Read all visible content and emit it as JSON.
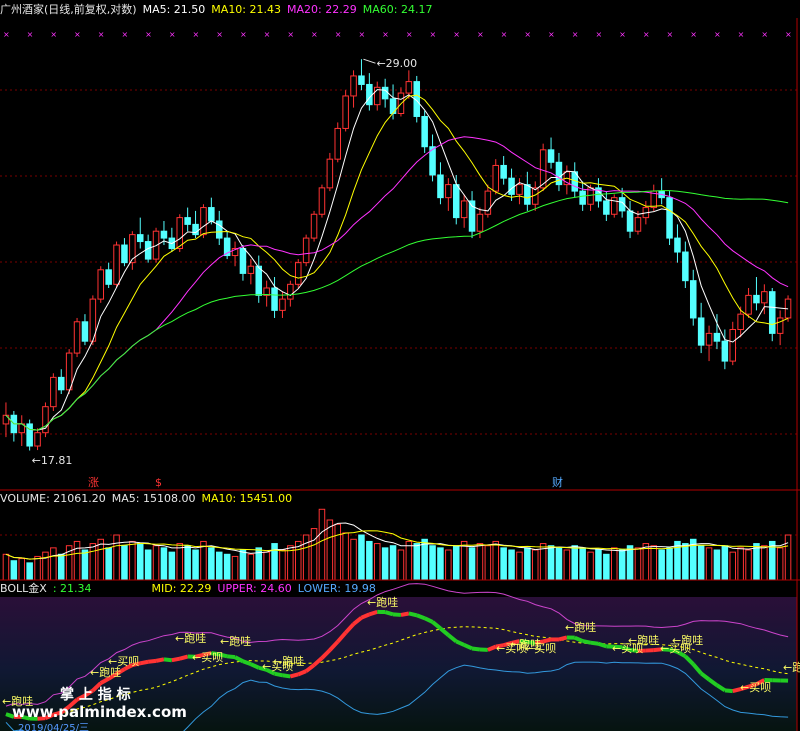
{
  "price_panel": {
    "header": [
      {
        "text": "广州酒家(日线,前复权,对数)",
        "color": "#e6e6e6"
      },
      {
        "text": "MA5: 21.50",
        "color": "#ffffff"
      },
      {
        "text": "MA10: 21.43",
        "color": "#ffff00"
      },
      {
        "text": "MA20: 22.29",
        "color": "#ff33ff"
      },
      {
        "text": "MA60: 24.17",
        "color": "#33ff33"
      }
    ],
    "high_label": "29.00",
    "low_label": "17.81",
    "markers": [
      {
        "text": "涨",
        "color": "#ff3333"
      },
      {
        "text": "$",
        "color": "#ff3333"
      },
      {
        "text": "财",
        "color": "#55aaff"
      }
    ]
  },
  "volume_panel": {
    "header": [
      {
        "text": "VOLUME: 21061.20",
        "color": "#e6e6e6"
      },
      {
        "text": "MA5: 15108.00",
        "color": "#e6e6e6"
      },
      {
        "text": "MA10: 15451.00",
        "color": "#ffff00"
      }
    ]
  },
  "boll_panel": {
    "header": [
      {
        "text": "BOLL金X",
        "color": "#e6e6e6"
      },
      {
        "text": ": 21.34",
        "color": "#33ff33"
      },
      {
        "text": "MID: 22.29",
        "color": "#ffff00"
      },
      {
        "text": "UPPER: 24.60",
        "color": "#ff33ff"
      },
      {
        "text": "LOWER: 19.98",
        "color": "#55aaff"
      }
    ],
    "signal_labels": [
      "跑哇",
      "跑哇",
      "跑哇",
      "买呗",
      "跑哇",
      "买呗",
      "跑哇",
      "买呗",
      "跑哇",
      "跑哇",
      "买呗",
      "跑哇",
      "买呗",
      "跑哇",
      "跑哇",
      "买呗",
      "买呗",
      "跑哇",
      "买呗"
    ],
    "watermark_cn": "掌 上 指 标",
    "watermark_url": "www.palmindex.com",
    "date_text": "2019/04/25/三"
  },
  "chart_data": [
    {
      "type": "candlestick",
      "title": "广州酒家(日线,前复权,对数)",
      "high": 29.0,
      "low": 17.81,
      "indicators": [
        {
          "name": "MA5",
          "value": 21.5,
          "color": "#ffffff"
        },
        {
          "name": "MA10",
          "value": 21.43,
          "color": "#ffff00"
        },
        {
          "name": "MA20",
          "value": 22.29,
          "color": "#ff33ff"
        },
        {
          "name": "MA60",
          "value": 24.17,
          "color": "#33ff33"
        }
      ],
      "up_color": "#ff3333",
      "down_color": "#54ffff",
      "candles": [
        [
          18.4,
          18.9,
          18.1,
          18.6
        ],
        [
          18.6,
          18.7,
          18.0,
          18.2
        ],
        [
          18.2,
          18.6,
          17.9,
          18.4
        ],
        [
          18.4,
          18.5,
          17.8,
          17.9
        ],
        [
          17.9,
          18.3,
          17.81,
          18.2
        ],
        [
          18.2,
          18.9,
          18.1,
          18.8
        ],
        [
          18.8,
          19.6,
          18.7,
          19.5
        ],
        [
          19.5,
          19.7,
          19.1,
          19.2
        ],
        [
          19.2,
          20.2,
          19.1,
          20.1
        ],
        [
          20.1,
          21.0,
          20.0,
          20.9
        ],
        [
          20.9,
          21.1,
          20.3,
          20.4
        ],
        [
          20.4,
          21.6,
          20.3,
          21.5
        ],
        [
          21.5,
          22.4,
          21.4,
          22.3
        ],
        [
          22.3,
          22.5,
          21.8,
          21.9
        ],
        [
          21.9,
          23.1,
          21.8,
          23.0
        ],
        [
          23.0,
          23.2,
          22.4,
          22.5
        ],
        [
          22.5,
          23.4,
          22.3,
          23.3
        ],
        [
          23.3,
          23.8,
          22.9,
          23.1
        ],
        [
          23.1,
          23.3,
          22.5,
          22.6
        ],
        [
          22.6,
          23.5,
          22.5,
          23.4
        ],
        [
          23.4,
          23.7,
          23.0,
          23.2
        ],
        [
          23.2,
          23.5,
          22.8,
          22.9
        ],
        [
          22.9,
          23.9,
          22.8,
          23.8
        ],
        [
          23.8,
          24.1,
          23.4,
          23.6
        ],
        [
          23.6,
          24.0,
          23.2,
          23.3
        ],
        [
          23.3,
          24.2,
          23.2,
          24.1
        ],
        [
          24.1,
          24.4,
          23.6,
          23.7
        ],
        [
          23.7,
          24.0,
          23.0,
          23.2
        ],
        [
          23.2,
          23.4,
          22.6,
          22.7
        ],
        [
          22.7,
          23.1,
          22.4,
          22.9
        ],
        [
          22.9,
          23.0,
          22.0,
          22.2
        ],
        [
          22.2,
          22.6,
          21.9,
          22.4
        ],
        [
          22.4,
          22.7,
          21.4,
          21.6
        ],
        [
          21.6,
          22.0,
          21.3,
          21.8
        ],
        [
          21.8,
          22.1,
          21.0,
          21.2
        ],
        [
          21.2,
          21.7,
          21.0,
          21.5
        ],
        [
          21.5,
          22.0,
          21.3,
          21.9
        ],
        [
          21.9,
          22.6,
          21.8,
          22.5
        ],
        [
          22.5,
          23.3,
          22.4,
          23.2
        ],
        [
          23.2,
          24.0,
          23.1,
          23.9
        ],
        [
          23.9,
          24.8,
          23.8,
          24.7
        ],
        [
          24.7,
          25.8,
          24.6,
          25.6
        ],
        [
          25.6,
          26.8,
          25.5,
          26.6
        ],
        [
          26.6,
          27.9,
          26.5,
          27.7
        ],
        [
          27.7,
          28.6,
          27.3,
          28.4
        ],
        [
          28.4,
          29.0,
          27.9,
          28.1
        ],
        [
          28.1,
          28.5,
          27.2,
          27.4
        ],
        [
          27.4,
          28.2,
          27.2,
          28.0
        ],
        [
          28.0,
          28.3,
          27.3,
          27.6
        ],
        [
          27.6,
          28.1,
          26.9,
          27.1
        ],
        [
          27.1,
          28.0,
          27.0,
          27.8
        ],
        [
          27.8,
          28.6,
          27.6,
          28.2
        ],
        [
          28.2,
          28.4,
          26.8,
          27.0
        ],
        [
          27.0,
          27.2,
          25.8,
          26.0
        ],
        [
          26.0,
          26.4,
          24.9,
          25.1
        ],
        [
          25.1,
          25.5,
          24.2,
          24.4
        ],
        [
          24.4,
          25.0,
          24.0,
          24.8
        ],
        [
          24.8,
          25.1,
          23.6,
          23.8
        ],
        [
          23.8,
          24.5,
          23.5,
          24.3
        ],
        [
          24.3,
          24.6,
          23.2,
          23.4
        ],
        [
          23.4,
          24.1,
          23.2,
          23.9
        ],
        [
          23.9,
          24.8,
          23.8,
          24.6
        ],
        [
          24.6,
          25.6,
          24.5,
          25.4
        ],
        [
          25.4,
          25.7,
          24.8,
          25.0
        ],
        [
          25.0,
          25.3,
          24.3,
          24.5
        ],
        [
          24.5,
          25.0,
          24.2,
          24.8
        ],
        [
          24.8,
          25.2,
          24.0,
          24.2
        ],
        [
          24.2,
          24.9,
          24.0,
          24.7
        ],
        [
          24.7,
          26.1,
          24.6,
          25.9
        ],
        [
          25.9,
          26.3,
          25.3,
          25.5
        ],
        [
          25.5,
          25.8,
          24.6,
          24.8
        ],
        [
          24.8,
          25.4,
          24.5,
          25.2
        ],
        [
          25.2,
          25.5,
          24.4,
          24.6
        ],
        [
          24.6,
          24.9,
          24.0,
          24.2
        ],
        [
          24.2,
          24.8,
          24.0,
          24.7
        ],
        [
          24.7,
          25.0,
          24.1,
          24.3
        ],
        [
          24.3,
          24.6,
          23.7,
          23.9
        ],
        [
          23.9,
          24.5,
          23.8,
          24.4
        ],
        [
          24.4,
          24.7,
          23.8,
          24.0
        ],
        [
          24.0,
          24.3,
          23.2,
          23.4
        ],
        [
          23.4,
          24.0,
          23.3,
          23.8
        ],
        [
          23.8,
          24.3,
          23.6,
          24.1
        ],
        [
          24.1,
          24.8,
          24.0,
          24.6
        ],
        [
          24.6,
          25.0,
          24.2,
          24.4
        ],
        [
          24.4,
          24.6,
          23.0,
          23.2
        ],
        [
          23.2,
          23.6,
          22.5,
          22.8
        ],
        [
          22.8,
          23.1,
          21.8,
          22.0
        ],
        [
          22.0,
          22.3,
          20.8,
          21.0
        ],
        [
          21.0,
          21.4,
          20.1,
          20.3
        ],
        [
          20.3,
          20.8,
          19.9,
          20.6
        ],
        [
          20.6,
          21.1,
          20.2,
          20.4
        ],
        [
          20.4,
          20.7,
          19.7,
          19.9
        ],
        [
          19.9,
          20.9,
          19.8,
          20.7
        ],
        [
          20.7,
          21.3,
          20.5,
          21.1
        ],
        [
          21.1,
          21.8,
          21.0,
          21.6
        ],
        [
          21.6,
          22.1,
          21.2,
          21.4
        ],
        [
          21.4,
          21.9,
          21.1,
          21.7
        ],
        [
          21.7,
          21.8,
          20.4,
          20.6
        ],
        [
          20.6,
          21.2,
          20.3,
          21.0
        ],
        [
          21.0,
          21.6,
          20.9,
          21.5
        ]
      ]
    },
    {
      "type": "bar",
      "title": "VOLUME",
      "series": [
        {
          "name": "VOLUME",
          "last": 21061.2
        },
        {
          "name": "MA5",
          "last": 15108.0
        },
        {
          "name": "MA10",
          "last": 15451.0
        }
      ],
      "values": [
        12,
        9,
        10,
        8,
        11,
        13,
        15,
        12,
        16,
        18,
        14,
        17,
        19,
        15,
        21,
        16,
        18,
        17,
        14,
        16,
        15,
        13,
        17,
        16,
        14,
        18,
        15,
        13,
        12,
        11,
        14,
        12,
        15,
        13,
        17,
        14,
        16,
        18,
        21,
        24,
        33,
        28,
        26,
        22,
        19,
        21,
        18,
        17,
        15,
        16,
        14,
        18,
        17,
        19,
        16,
        15,
        14,
        16,
        18,
        15,
        17,
        16,
        18,
        15,
        14,
        13,
        15,
        14,
        17,
        16,
        15,
        14,
        16,
        15,
        13,
        14,
        12,
        15,
        14,
        16,
        15,
        17,
        16,
        14,
        15,
        18,
        17,
        19,
        16,
        15,
        14,
        16,
        13,
        15,
        14,
        17,
        16,
        18,
        15,
        21
      ]
    },
    {
      "type": "line",
      "title": "BOLL金X",
      "series": [
        {
          "name": "BOLL金X",
          "last": 21.34
        },
        {
          "name": "MID",
          "last": 22.29
        },
        {
          "name": "UPPER",
          "last": 24.6
        },
        {
          "name": "LOWER",
          "last": 19.98
        }
      ]
    }
  ]
}
